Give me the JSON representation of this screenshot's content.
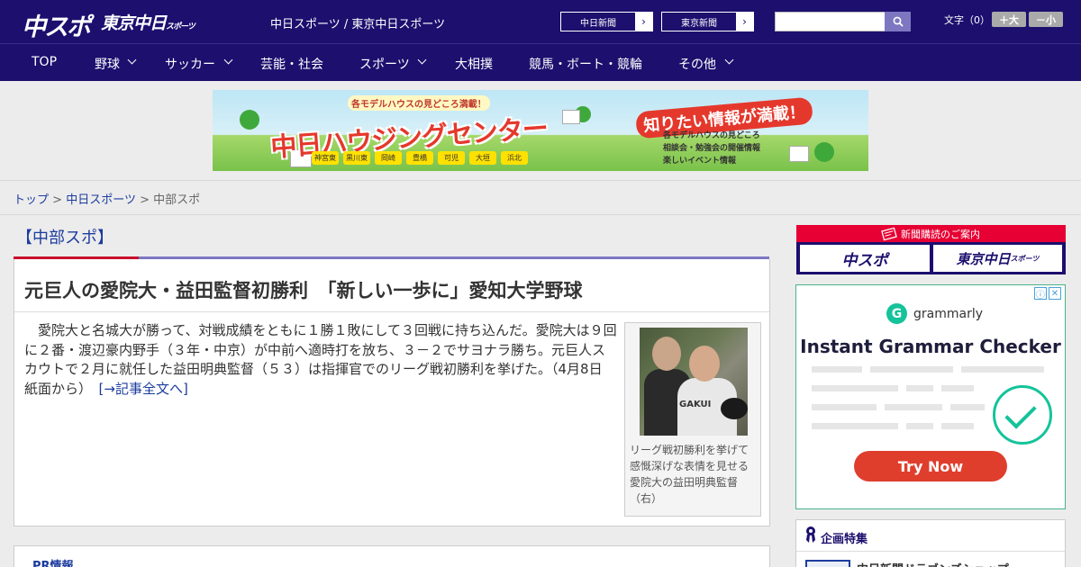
{
  "header": {
    "logo_main": "中スポ",
    "logo_sub": "東京中日",
    "logo_sub_small": "スポーツ",
    "site_title": "中日スポーツ / 東京中日スポーツ",
    "ext_links": [
      {
        "label": "中日新聞",
        "arrow": "›"
      },
      {
        "label": "東京新聞",
        "arrow": "›"
      }
    ],
    "search": {
      "placeholder": "",
      "icon": "search-icon"
    },
    "font_size": {
      "label": "文字（0）",
      "larger": "＋大",
      "smaller": "－小"
    }
  },
  "nav": {
    "items": [
      {
        "label": "TOP",
        "has_menu": false
      },
      {
        "label": "野球",
        "has_menu": true
      },
      {
        "label": "サッカー",
        "has_menu": true
      },
      {
        "label": "芸能・社会",
        "has_menu": false
      },
      {
        "label": "スポーツ",
        "has_menu": true
      },
      {
        "label": "大相撲",
        "has_menu": false
      },
      {
        "label": "競馬・ボート・競輪",
        "has_menu": false
      },
      {
        "label": "その他",
        "has_menu": true
      }
    ]
  },
  "banner": {
    "top_text": "各モデルハウスの見どころ満載！",
    "main_text": "中日ハウジングセンター",
    "badge_text": "知りたい情報が満載！",
    "info_lines": [
      "各モデルハウスの見どころ",
      "相談会・勉強会の開催情報",
      "楽しいイベント情報"
    ],
    "cities": [
      "神宮東",
      "黒川東",
      "岡崎",
      "豊橋",
      "可児",
      "大垣",
      "浜北"
    ]
  },
  "breadcrumb": {
    "items": [
      {
        "label": "トップ",
        "link": true
      },
      {
        "label": "中日スポーツ",
        "link": true
      },
      {
        "label": "中部スポ",
        "link": false
      }
    ],
    "separator": ">"
  },
  "section": {
    "title": "【中部スポ】"
  },
  "article": {
    "title": "元巨人の愛院大・益田監督初勝利　「新しい一歩に」愛知大学野球",
    "body": "愛院大と名城大が勝って、対戦成績をともに１勝１敗にして３回戦に持ち込んだ。愛院大は９回に２番・渡辺豪内野手（３年・中京）が中前へ適時打を放ち、３－２でサヨナラ勝ち。元巨人スカウトで２月に就任した益田明典監督（５３）は指揮官でのリーグ戦初勝利を挙げた。（4月8日 紙面から）",
    "more_link": "[→記事全文へ]",
    "photo_caption": "リーグ戦初勝利を挙げて感慨深げな表情を見せる愛院大の益田明典監督（右）",
    "photo_text": "GAKUI"
  },
  "pr": {
    "title": "PR情報"
  },
  "sidebar": {
    "subscribe": {
      "title": "新聞購読のご案内",
      "buttons": [
        "中スポ",
        "東京中日"
      ],
      "buttons_small": [
        "",
        "スポーツ"
      ]
    },
    "ad": {
      "brand": "grammarly",
      "brand_icon": "G",
      "headline": "Instant Grammar Checker",
      "cta": "Try Now",
      "info_icon": "ⓘ",
      "close_icon": "✕"
    },
    "features": {
      "title": "企画特集",
      "items": [
        "中日新聞ドラゴンズショップ"
      ]
    }
  },
  "colors": {
    "brand": "#1c0f6e",
    "accent_red": "#c8102e",
    "accent_purple": "#7d77c2",
    "link": "#1c3c9e",
    "ad_green": "#15c39a",
    "ad_cta": "#e03e2d"
  }
}
